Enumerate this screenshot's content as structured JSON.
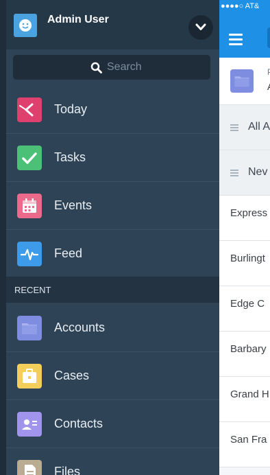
{
  "user": {
    "name": "Admin User"
  },
  "search": {
    "placeholder": "Search"
  },
  "nav": {
    "items": [
      {
        "label": "Today",
        "icon": "today-icon",
        "color": "#e0406d"
      },
      {
        "label": "Tasks",
        "icon": "checkmark-icon",
        "color": "#4bc076"
      },
      {
        "label": "Events",
        "icon": "calendar-icon",
        "color": "#eb6a8b"
      },
      {
        "label": "Feed",
        "icon": "pulse-icon",
        "color": "#3d9be9"
      }
    ]
  },
  "recent": {
    "header": "RECENT",
    "items": [
      {
        "label": "Accounts",
        "icon": "folder-icon",
        "color": "#7f8de1"
      },
      {
        "label": "Cases",
        "icon": "briefcase-icon",
        "color": "#f2cf5b"
      },
      {
        "label": "Contacts",
        "icon": "contact-card-icon",
        "color": "#a094ed"
      },
      {
        "label": "Files",
        "icon": "file-icon",
        "color": "#baac93"
      }
    ]
  },
  "main": {
    "status": "●●●●○ AT&",
    "object_type": "P",
    "object_name": "A",
    "list_views": [
      "All A",
      "Nev"
    ],
    "records": [
      "Express",
      "Burlingt",
      "Edge C",
      "Barbary",
      "Grand H",
      "San Fra"
    ]
  },
  "colors": {
    "sidebar_bg": "#2e4355",
    "header_bg": "#253848",
    "accent_blue": "#1e90e6"
  }
}
